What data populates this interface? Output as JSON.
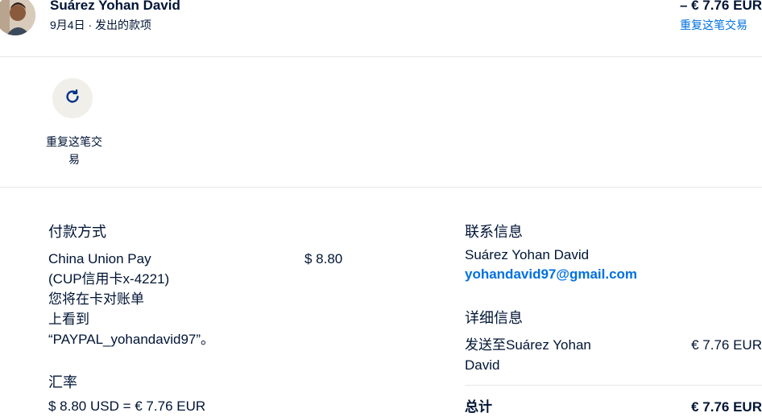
{
  "header": {
    "name": "Suárez Yohan David",
    "subtitle": "9月4日 · 发出的款项",
    "amount": "– € 7.76 EUR",
    "repeat_link": "重复这笔交易"
  },
  "actions": {
    "repeat_label": "重复这笔交易",
    "repeat_icon": "refresh-icon"
  },
  "payment": {
    "title": "付款方式",
    "method_lines": [
      "China Union Pay",
      "(CUP信用卡x-4221)",
      "您将在卡对账单",
      "上看到",
      "“PAYPAL_yohandavid97”。"
    ],
    "method_amount": "$ 8.80",
    "rate_title": "汇率",
    "rate_value": "$ 8.80 USD = € 7.76 EUR"
  },
  "contact": {
    "title": "联系信息",
    "name": "Suárez Yohan David",
    "email": "yohandavid97@gmail.com"
  },
  "details": {
    "title": "详细信息",
    "line_lines": [
      "发送至Suárez Yohan",
      "David"
    ],
    "line_amount": "€ 7.76 EUR",
    "total_label": "总计",
    "total_amount": "€ 7.76 EUR"
  }
}
